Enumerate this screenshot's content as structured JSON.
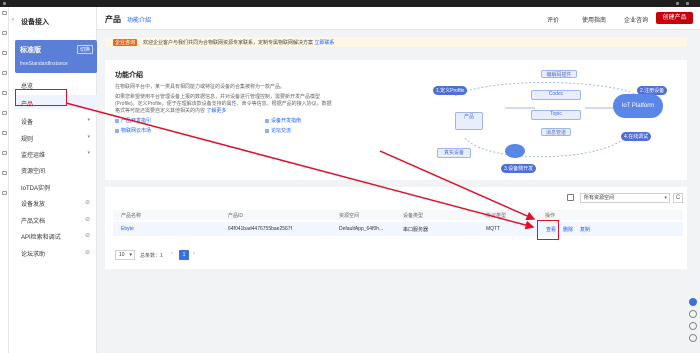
{
  "sidebar": {
    "back": "‹",
    "title": "设备接入",
    "instance": {
      "edition": "标准版",
      "switch": "切换",
      "name": "freeStandardInstance"
    },
    "items": [
      {
        "label": "总览"
      },
      {
        "label": "产品"
      },
      {
        "label": "设备"
      },
      {
        "label": "规则"
      },
      {
        "label": "监控运维"
      },
      {
        "label": "资源空间"
      },
      {
        "label": "IoTDA实例"
      },
      {
        "label": "设备发放"
      },
      {
        "label": "产品文档"
      },
      {
        "label": "API检索和调试"
      },
      {
        "label": "论坛求助"
      }
    ]
  },
  "header": {
    "title": "产品",
    "intro_link": "功能介绍",
    "rating": "评价",
    "guide": "使用指南",
    "enterprise": "企业咨询",
    "create": "创建产品"
  },
  "banner": {
    "tag": "企业咨询",
    "text": "欢迎企业客户与我们共同为合物联网资源专家联系，定制专属物联网解决方案",
    "link": "立即联系"
  },
  "intro": {
    "title": "功能介绍",
    "p1": "在物联网平台中，某一类具有相同能力或特征的设备的合集被称为一款产品。",
    "p2": "如果您希望使用平台管理设备上报的数据信息，并对设备进行管理控制，需要新开发产品模型(Profile)。定义Profile，便于在理解该款设备支持的属性、命令等信息。根据产品的接入协议，数据格式等可能还需要自定义其他相关的内容",
    "more": "了解更多",
    "links": [
      "产品开发指引",
      "设备开发指南",
      "物联网云市场",
      "论坛交流"
    ]
  },
  "diagram": {
    "steps": [
      "1.定义Profile",
      "2.注册设备",
      "3.设备侧开发",
      "4.在线调试"
    ],
    "boxes": [
      "编解码插件",
      "Codec",
      "Topic",
      "消息管道",
      "产品",
      "真实设备"
    ],
    "cloud": "IoT Platform"
  },
  "list": {
    "space_select": "所有资源空间",
    "refresh": "C",
    "columns": [
      "产品名称",
      "产品ID",
      "资源空间",
      "设备类型",
      "协议类型",
      "操作"
    ],
    "rows": [
      {
        "name": "Ebyte",
        "id": "64f041bad4476755bae2567f",
        "space": "DefaultApp_64f0h...",
        "device_type": "串口服务器",
        "protocol": "MQTT",
        "actions": [
          "查看",
          "删除",
          "复制"
        ]
      }
    ]
  },
  "pager": {
    "size": "10",
    "total_label": "总条数：",
    "total": "1",
    "prev": "‹",
    "page": "1",
    "next": "›"
  },
  "colors": {
    "accent": "#c7000b",
    "link": "#1a5cff",
    "annotation": "#e0102a",
    "primary": "#3a6fe0"
  }
}
